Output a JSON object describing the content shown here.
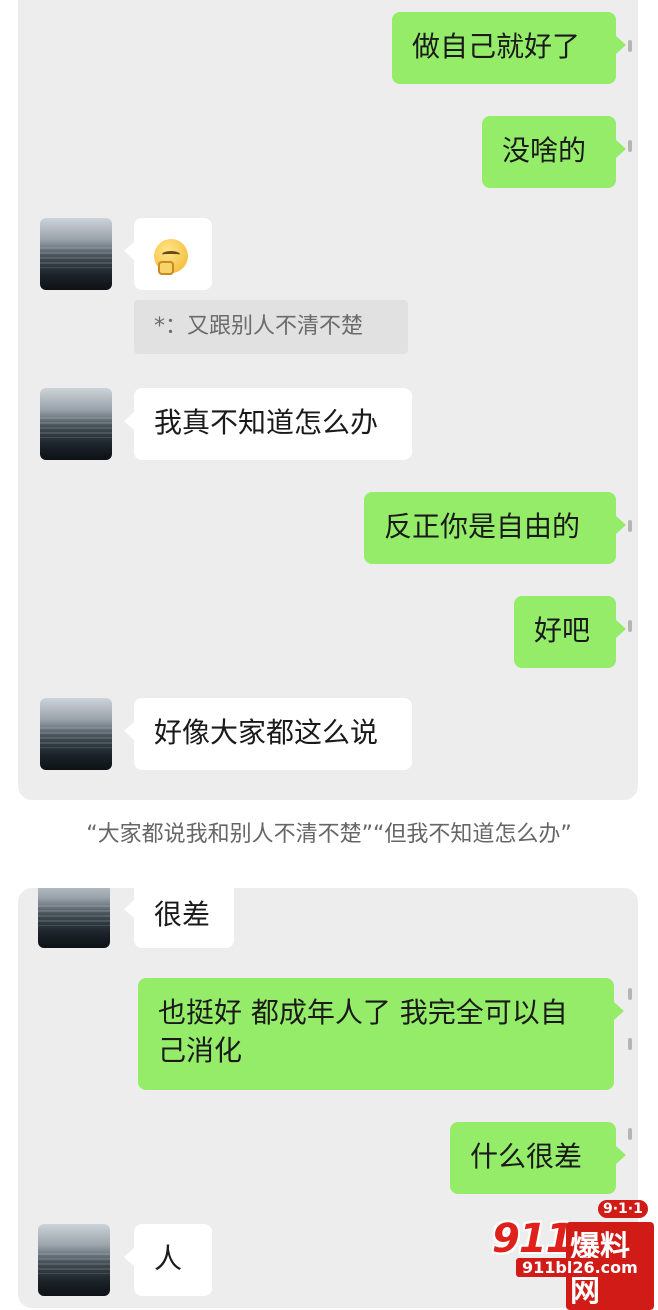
{
  "screenshot1": {
    "messages": [
      {
        "side": "out",
        "text": "做自己就好了"
      },
      {
        "side": "out",
        "text": "没啥的"
      },
      {
        "side": "in",
        "emoji": "thinking-sad-emoji"
      },
      {
        "quote": "*：又跟别人不清不楚"
      },
      {
        "side": "in",
        "text": "我真不知道怎么办"
      },
      {
        "side": "out",
        "text": "反正你是自由的"
      },
      {
        "side": "out",
        "text": "好吧"
      },
      {
        "side": "in",
        "text": "好像大家都这么说"
      }
    ]
  },
  "caption": "“大家都说我和别人不清不楚”“但我不知道怎么办”",
  "screenshot2": {
    "messages": [
      {
        "side": "in",
        "text": "很差"
      },
      {
        "side": "out",
        "text": "也挺好 都成年人了 我完全可以自己消化"
      },
      {
        "side": "out",
        "text": "什么很差"
      },
      {
        "side": "in",
        "text": "人"
      }
    ]
  },
  "watermark": {
    "brand": "911",
    "name": "爆料网",
    "badge": "9·1·1",
    "url": "911bl26.com"
  },
  "colors": {
    "outgoing_bubble": "#95ec69",
    "incoming_bubble": "#ffffff",
    "chat_background": "#ededed",
    "watermark_red": "#d11b16"
  }
}
